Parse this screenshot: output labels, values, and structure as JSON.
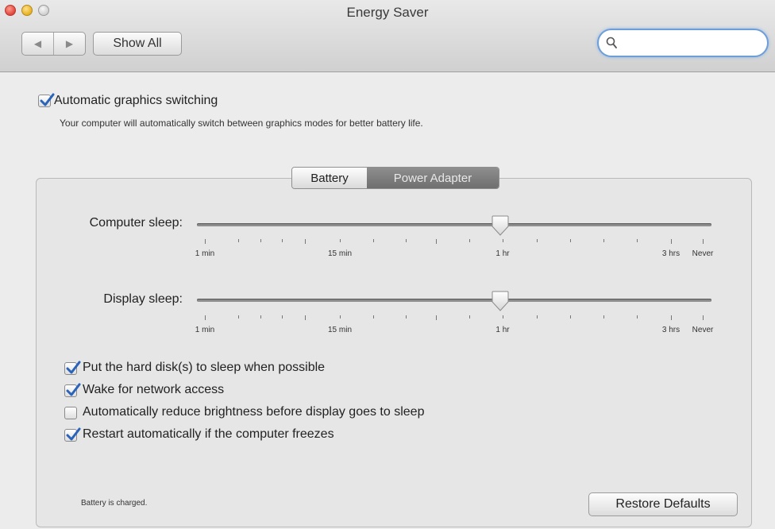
{
  "window": {
    "title": "Energy Saver"
  },
  "toolbar": {
    "back_glyph": "◀",
    "forward_glyph": "▶",
    "show_all_label": "Show All",
    "search_value": "",
    "search_placeholder": ""
  },
  "graphics": {
    "label": "Automatic graphics switching",
    "checked": true,
    "description": "Your computer will automatically switch between graphics modes for better battery life."
  },
  "tabs": [
    {
      "label": "Battery",
      "selected": false
    },
    {
      "label": "Power Adapter",
      "selected": true
    }
  ],
  "sliders": {
    "computer": {
      "label": "Computer sleep:",
      "value": "1 hr",
      "position_fraction": 0.59
    },
    "display": {
      "label": "Display sleep:",
      "value": "1 hr",
      "position_fraction": 0.59
    },
    "tick_labels": [
      "1 min",
      "15 min",
      "1 hr",
      "3 hrs",
      "Never"
    ]
  },
  "options": [
    {
      "label": "Put the hard disk(s) to sleep when possible",
      "checked": true
    },
    {
      "label": "Wake for network access",
      "checked": true
    },
    {
      "label": "Automatically reduce brightness before display goes to sleep",
      "checked": false
    },
    {
      "label": "Restart automatically if the computer freezes",
      "checked": true
    }
  ],
  "status": {
    "text": "Battery is charged."
  },
  "buttons": {
    "restore_defaults": "Restore Defaults"
  },
  "colors": {
    "check_blue": "#2a63b8",
    "search_focus": "#6d9ed8",
    "selected_tab": "#7d7d7d"
  }
}
